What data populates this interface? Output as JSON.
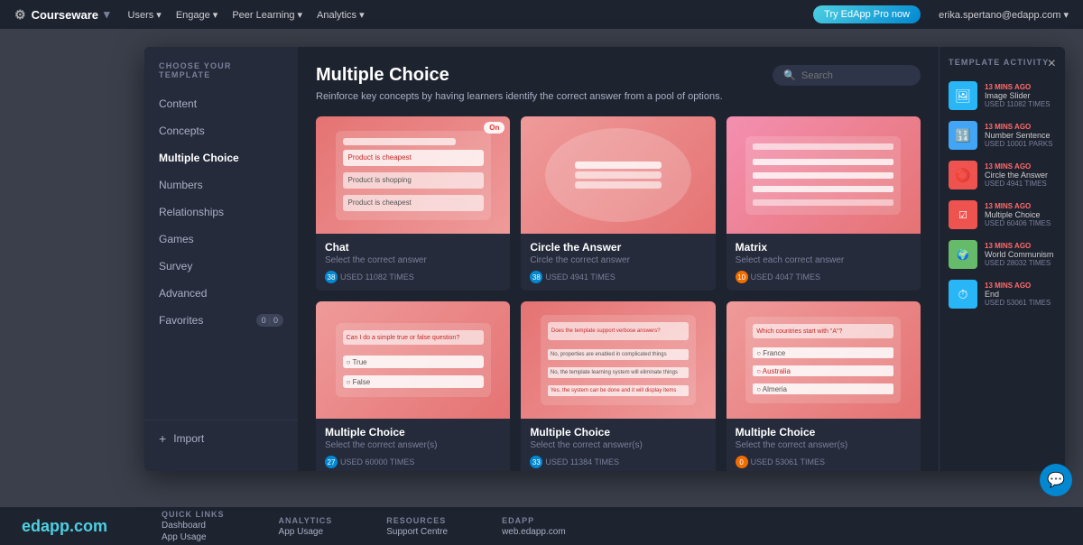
{
  "topnav": {
    "logo": "Courseware",
    "nav_items": [
      "Users ▾",
      "Engage ▾",
      "Peer Learning ▾",
      "Analytics ▾"
    ],
    "cta": "Try EdApp Pro now",
    "user": "erika.spertano@edapp.com ▾"
  },
  "sidebar": {
    "title": "CHOOSE YOUR TEMPLATE",
    "items": [
      {
        "label": "Content",
        "active": false
      },
      {
        "label": "Concepts",
        "active": false
      },
      {
        "label": "Multiple Choice",
        "active": true
      },
      {
        "label": "Numbers",
        "active": false
      },
      {
        "label": "Relationships",
        "active": false
      },
      {
        "label": "Games",
        "active": false
      },
      {
        "label": "Survey",
        "active": false
      },
      {
        "label": "Advanced",
        "active": false
      },
      {
        "label": "Favorites",
        "badge": "0",
        "badge2": "0",
        "active": false
      }
    ],
    "import_label": "Import"
  },
  "modal": {
    "title": "Multiple Choice",
    "description": "Reinforce key concepts by having learners identify the correct answer from a pool of options.",
    "search_placeholder": "Search",
    "close": "×"
  },
  "templates": [
    {
      "name": "Chat",
      "desc": "Select the correct answer",
      "stat1": "38",
      "stat1_label": "USED 11082 TIMES",
      "stat_color1": "blue"
    },
    {
      "name": "Circle the Answer",
      "desc": "Circle the correct answer",
      "stat1": "38",
      "stat1_label": "USED 4941 TIMES",
      "stat_color1": "blue"
    },
    {
      "name": "Matrix",
      "desc": "Select each correct answer",
      "stat1": "10",
      "stat1_label": "USED 4047 TIMES",
      "stat_color1": "orange"
    },
    {
      "name": "Multiple Choice",
      "desc": "Select the correct answer(s)",
      "stat1": "27",
      "stat1_label": "USED 60000 TIMES",
      "stat_color1": "blue"
    },
    {
      "name": "Multiple Choice",
      "desc": "Select the correct answer(s)",
      "stat1": "33",
      "stat1_label": "USED 11384 TIMES",
      "stat_color1": "blue"
    },
    {
      "name": "Multiple Choice",
      "desc": "Select the correct answer(s)",
      "stat1": "0",
      "stat1_label": "USED 53061 TIMES",
      "stat_color1": "orange"
    }
  ],
  "activity": {
    "title": "TEMPLATE ACTIVITY",
    "items": [
      {
        "time": "13 MINS AGO",
        "name": "Image Slider",
        "meta": "USED 11082 TIMES",
        "color": "#29b6f6"
      },
      {
        "time": "13 MINS AGO",
        "name": "Number Sentence",
        "meta": "USED 10001 PARKS",
        "color": "#42a5f5"
      },
      {
        "time": "13 MINS AGO",
        "name": "Circle the Answer",
        "meta": "USED 4941 TIMES",
        "color": "#ef5350"
      },
      {
        "time": "13 MINS AGO",
        "name": "Multiple Choice",
        "meta": "USED 60406 TIMES",
        "color": "#ef5350"
      },
      {
        "time": "13 MINS AGO",
        "name": "World Communism",
        "meta": "USED 28032 TIMES",
        "color": "#66bb6a"
      },
      {
        "time": "13 MINS AGO",
        "name": "End",
        "meta": "USED 53061 TIMES",
        "color": "#29b6f6"
      }
    ]
  },
  "footer": {
    "brand": "edapp.com",
    "sections": [
      {
        "title": "QUICK LINKS",
        "links": [
          "Dashboard",
          "App Usage"
        ]
      },
      {
        "title": "ANALYTICS",
        "links": [
          "App Usage"
        ]
      },
      {
        "title": "RESOURCES",
        "links": [
          "Support Centre"
        ]
      },
      {
        "title": "EDAPP",
        "links": [
          "web.edapp.com"
        ]
      }
    ]
  }
}
